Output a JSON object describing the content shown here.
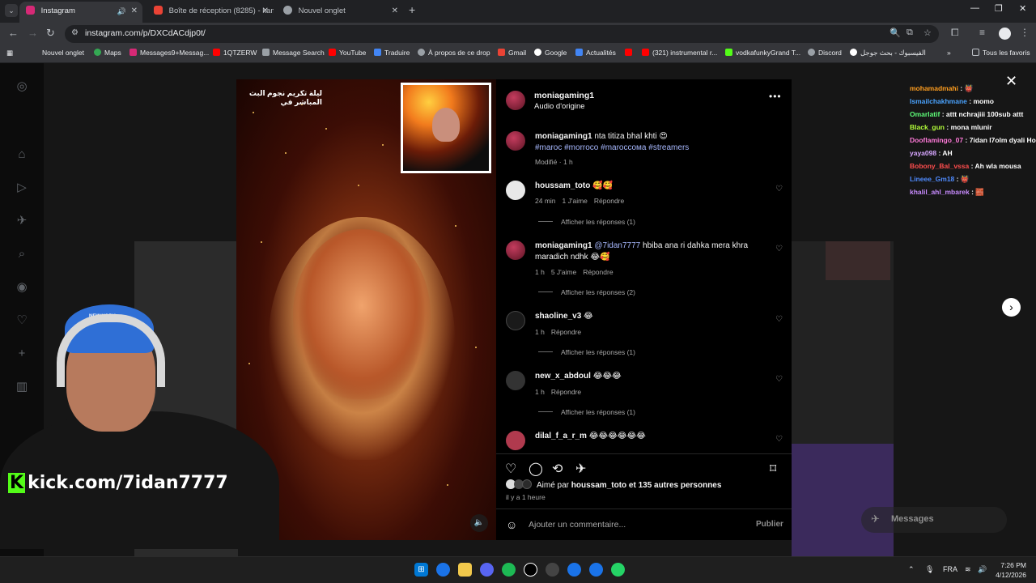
{
  "tabs": [
    {
      "label": "Instagram",
      "active": true
    },
    {
      "label": "Boîte de réception (8285) - kam",
      "active": false
    },
    {
      "label": "Nouvel onglet",
      "active": false
    }
  ],
  "address_bar": {
    "url": "instagram.com/p/DXCdACdjp0t/"
  },
  "bookmarks": [
    "Nouvel onglet",
    "Maps",
    "Messages9+Messag...",
    "1QTZERW",
    "Message Search",
    "YouTube",
    "Traduire",
    "À propos de ce drop",
    "Gmail",
    "Google",
    "Actualités",
    "(321) instrumental r...",
    "vodkafunkyGrand T...",
    "Discord",
    "الفيسبوك - بحث جوجل",
    "Tous les favoris"
  ],
  "post": {
    "media_title": "ليلة تكريم نجوم البث المباشر في",
    "username": "moniagaming1",
    "audio": "Audio d'origine",
    "caption_user": "moniagaming1",
    "caption_text": "nta titiza bhal khti 😍",
    "caption_tags": "#maroc #morroco #maroccoма #streamers",
    "caption_meta": "Modifié · 1 h",
    "comments": [
      {
        "user": "houssam_toto",
        "text": "🥰🥰",
        "time": "24 min",
        "likes": "1 J'aime",
        "reply": "Répondre",
        "replies": "Afficher les réponses (1)"
      },
      {
        "user": "moniagaming1",
        "mention": "@7idan7777",
        "text": "hbiba ana ri dahka mera khra maradich ndhk 😂🥰",
        "time": "1 h",
        "likes": "5 J'aime",
        "reply": "Répondre",
        "replies": "Afficher les réponses (2)"
      },
      {
        "user": "shaoline_v3",
        "text": "😂",
        "time": "1 h",
        "likes": "",
        "reply": "Répondre",
        "replies": "Afficher les réponses (1)"
      },
      {
        "user": "new_x_abdoul",
        "text": "😂😂😂",
        "time": "1 h",
        "likes": "",
        "reply": "Répondre",
        "replies": "Afficher les réponses (1)"
      },
      {
        "user": "dilal_f_a_r_m",
        "text": "😂😂😂😂😂😂"
      }
    ],
    "likes_prefix": "Aimé par",
    "likes_user": "houssam_toto",
    "likes_suffix": "et 135 autres personnes",
    "ago": "il y a 1 heure",
    "comment_placeholder": "Ajouter un commentaire...",
    "publish": "Publier"
  },
  "chat": [
    {
      "user": "mohamadmahi",
      "msg": "👹",
      "color": "#ff9e1f"
    },
    {
      "user": "Ismailchakhmane",
      "msg": "momo",
      "color": "#4aa3ff"
    },
    {
      "user": "Omarlatif",
      "msg": "attt nchrajiii 100sub attt",
      "color": "#5fff7a"
    },
    {
      "user": "Black_gun",
      "msg": "mona mlunir",
      "color": "#b4ff3a"
    },
    {
      "user": "Dooflamingo_07",
      "msg": "7idan l7olm dyali Ho",
      "color": "#ff7ad9"
    },
    {
      "user": "yaya098",
      "msg": "AH",
      "color": "#d7a6ff"
    },
    {
      "user": "Bobony_Bal_vssa",
      "msg": "Ah wla mousa",
      "color": "#ff4d4d"
    },
    {
      "user": "Lineee_Gm18",
      "msg": "👹",
      "color": "#4f8bff"
    },
    {
      "user": "khalil_ahl_mbarek",
      "msg": "🧱",
      "color": "#c88bff"
    }
  ],
  "stream_overlay": {
    "kick_url": "kick.com/7idan7777",
    "cap_text": "NEW YORK"
  },
  "messages_chip": "Messages",
  "taskbar": {
    "lang": "FRA",
    "time": "7:26 PM",
    "date": "4/12/2026"
  }
}
